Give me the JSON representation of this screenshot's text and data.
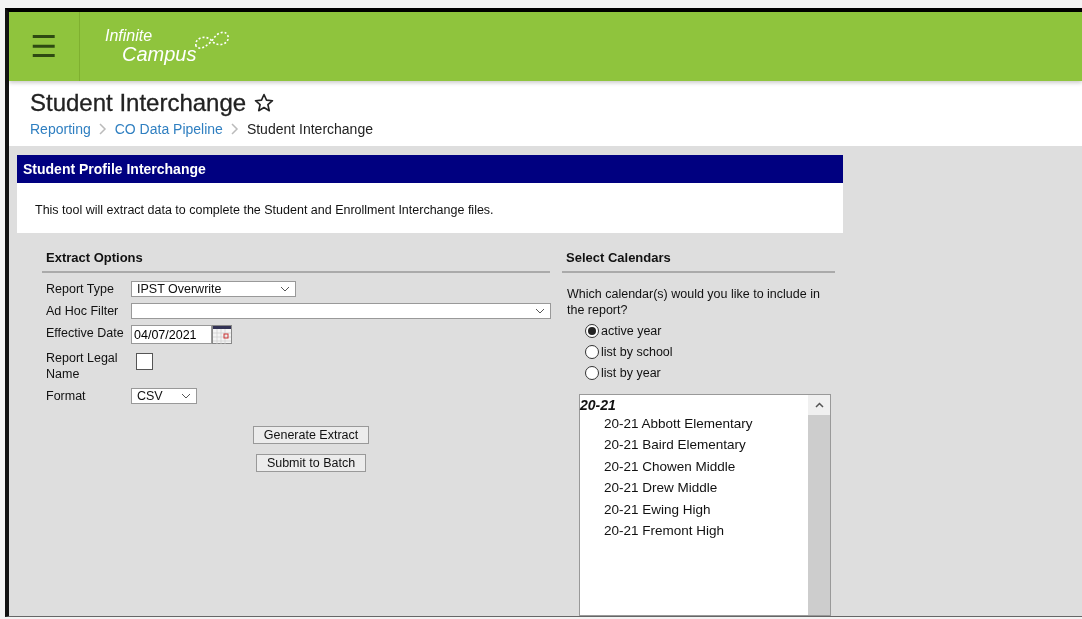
{
  "header": {
    "menu_label": "☰",
    "logo_top": "Infinite",
    "logo_bottom": "Campus"
  },
  "page": {
    "title": "Student Interchange",
    "favorite": false,
    "breadcrumbs": [
      {
        "label": "Reporting",
        "kind": "link"
      },
      {
        "label": "CO Data Pipeline",
        "kind": "link"
      },
      {
        "label": "Student Interchange",
        "kind": "current"
      }
    ]
  },
  "panel": {
    "title": "Student Profile Interchange",
    "description": "This tool will extract data to complete the Student and Enrollment Interchange files."
  },
  "extract_options": {
    "heading": "Extract Options",
    "fields": [
      {
        "kind": "dropdown",
        "label": "Report Type",
        "value": "IPST Overwrite"
      },
      {
        "kind": "filter",
        "label": "Ad Hoc Filter"
      },
      {
        "kind": "date",
        "label": "Effective Date",
        "value": "04/07/2021"
      },
      {
        "kind": "checkbox",
        "label": "Report Legal Name",
        "checked": false
      },
      {
        "kind": "short",
        "label": "Format",
        "value": "CSV"
      }
    ],
    "buttons": [
      "Generate Extract",
      "Submit to Batch"
    ]
  },
  "select_calendars": {
    "heading": "Select Calendars",
    "question": "Which calendar(s) would you like to include in the report?",
    "options": [
      {
        "label": "active year",
        "selected": true
      },
      {
        "label": "list by school",
        "selected": false
      },
      {
        "label": "list by year",
        "selected": false
      }
    ],
    "calendars": [
      {
        "label": "20-21",
        "children": [
          {
            "label": "20-21 Abbott Elementary"
          },
          {
            "label": "20-21 Baird Elementary"
          },
          {
            "label": "20-21 Chowen Middle"
          },
          {
            "label": "20-21 Drew Middle"
          },
          {
            "label": "20-21 Ewing High"
          },
          {
            "label": "20-21 Fremont High"
          }
        ]
      }
    ]
  }
}
